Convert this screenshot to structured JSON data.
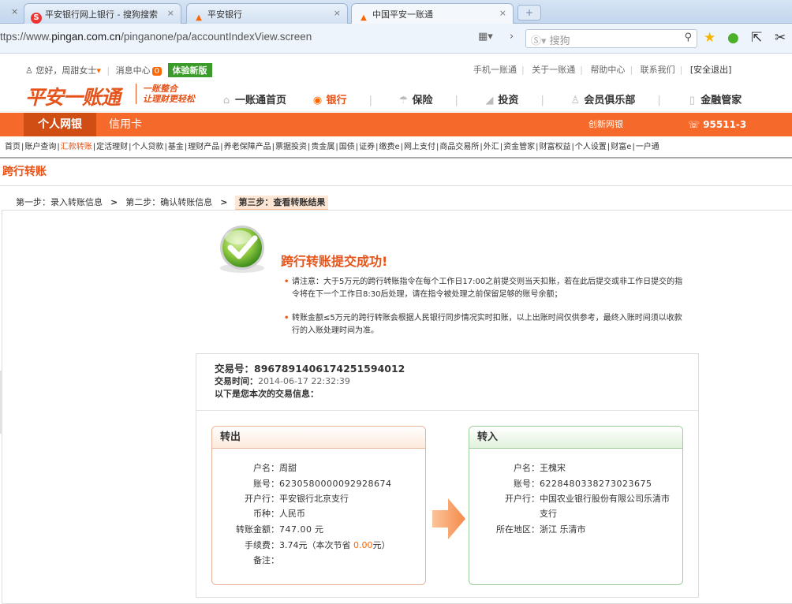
{
  "browser": {
    "tabs": [
      {
        "icon": "sogou-icon",
        "title": "平安银行网上银行 - 搜狗搜索"
      },
      {
        "icon": "pingan-icon",
        "title": "平安银行"
      },
      {
        "icon": "pingan-icon",
        "title": "中国平安一账通"
      }
    ],
    "new_tab": "+",
    "url_prefix": "ttps://www.",
    "url_host": "pingan.com.cn",
    "url_path": "/pinganone/pa/accountIndexView.screen",
    "search_placeholder": "搜狗"
  },
  "topbar": {
    "greeting": "您好，周甜女士",
    "messages": "消息中心",
    "msg_count": "0",
    "trial": "体验新版",
    "links": [
      "手机一账通",
      "关于一账通",
      "帮助中心",
      "联系我们",
      "[安全退出]"
    ]
  },
  "brand": {
    "logo": "平安一账通",
    "slogan1": "一账整合",
    "slogan2": "让理财更轻松"
  },
  "mainnav": [
    "一账通首页",
    "银行",
    "保险",
    "投资",
    "会员俱乐部",
    "金融管家"
  ],
  "orangebar": {
    "tabs": [
      "个人网银",
      "信用卡"
    ],
    "right1": "创新网银",
    "phone": "95511-3"
  },
  "subnav": [
    "首页",
    "账户查询",
    "汇款转账",
    "定活理财",
    "个人贷款",
    "基金",
    "理财产品",
    "养老保障产品",
    "票据投资",
    "贵金属",
    "国债",
    "证券",
    "缴费e",
    "网上支付",
    "商品交易所",
    "外汇",
    "资金管家",
    "财富权益",
    "个人设置",
    "财富e",
    "一户通"
  ],
  "page_title": "跨行转账",
  "steps": [
    "第一步：录入转账信息",
    "第二步：确认转账信息",
    "第三步：查看转账结果"
  ],
  "step_arrow": ">",
  "result": {
    "title": "跨行转账提交成功!",
    "note1": "请注意：大于5万元的跨行转账指令在每个工作日17:00之前提交则当天扣账，若在此后提交或非工作日提交的指令将在下一个工作日8:30后处理，请在指令被处理之前保留足够的账号余额；",
    "note2": "转账金额≤5万元的跨行转账会根据人民银行同步情况实时扣账，以上出账时间仅供参考，最终入账时间须以收款行的入账处理时间为准。"
  },
  "transaction": {
    "id_label": "交易号：",
    "id": "896789140617425159401​2",
    "time_label": "交易时间：",
    "time": "2014-06-17 22:32:39",
    "info_label": "以下是您本次的交易信息："
  },
  "out": {
    "title": "转出",
    "name_k": "户名：",
    "name": "周甜",
    "acct_k": "账号：",
    "acct": "6230580000092928674",
    "bank_k": "开户行：",
    "bank": "平安银行北京支行",
    "cur_k": "币种：",
    "cur": "人民币",
    "amt_k": "转账金额：",
    "amt": "747.00",
    "amt_unit": "元",
    "fee_k": "手续费：",
    "fee": "3.74元（本次节省",
    "fee_saved": "0.00",
    "fee_end": "元）",
    "memo_k": "备注：",
    "memo": ""
  },
  "in": {
    "title": "转入",
    "name_k": "户名：",
    "name": "王槐宋",
    "acct_k": "账号：",
    "acct": "6228480338273023675",
    "bank_k": "开户行：",
    "bank1": "中国农业银行股份有限公司乐清市",
    "bank2": "支行",
    "area_k": "所在地区：",
    "area": "浙江  乐清市"
  },
  "colors": {
    "accent": "#f5692b",
    "brand": "#e5541b",
    "success": "#5aa532"
  }
}
